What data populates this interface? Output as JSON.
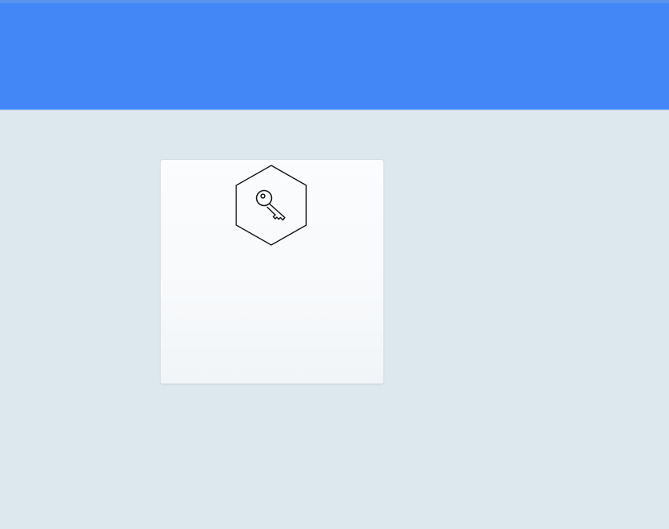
{
  "header": {
    "color": "#4287f5"
  },
  "card": {
    "icon": "key-icon",
    "badge_shape": "hexagon",
    "background": "#f8fafc"
  },
  "page": {
    "background": "#dde7ee"
  }
}
